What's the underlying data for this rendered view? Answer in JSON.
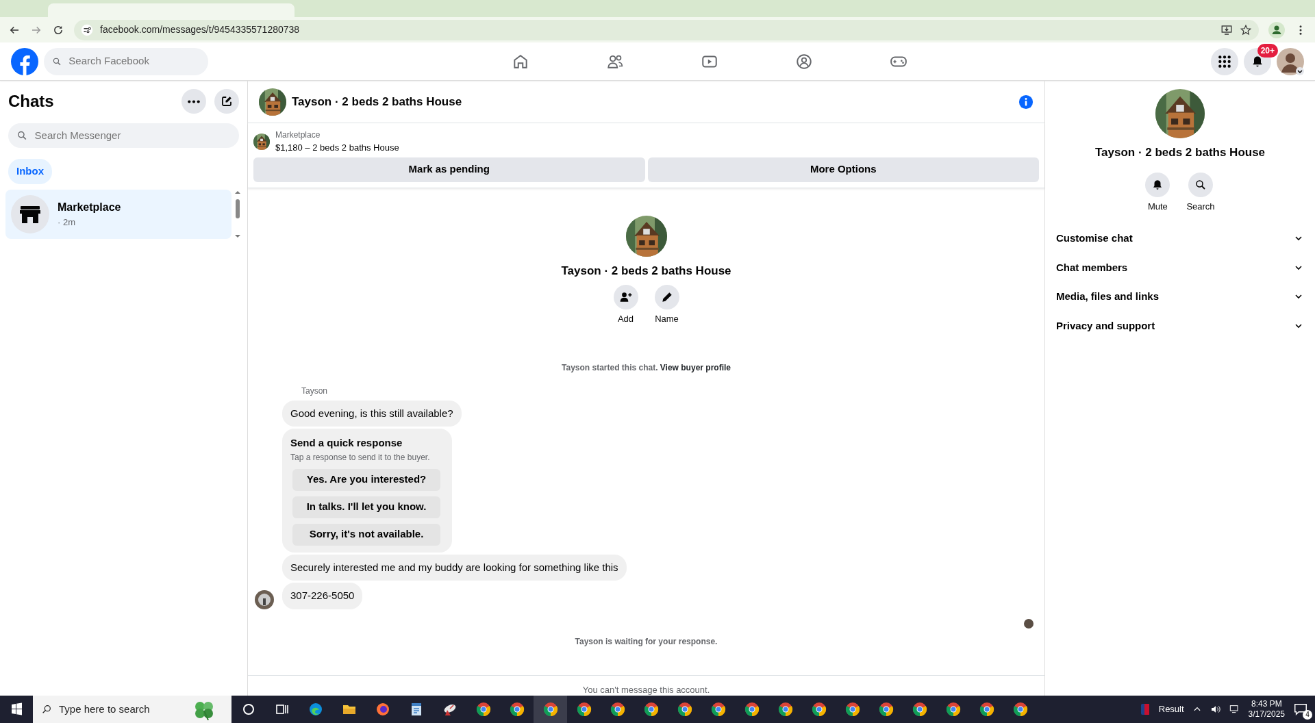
{
  "browser": {
    "url": "facebook.com/messages/t/9454335571280738"
  },
  "topbar": {
    "search_placeholder": "Search Facebook",
    "nav": [
      {
        "kind": "home"
      },
      {
        "kind": "friends"
      },
      {
        "kind": "video"
      },
      {
        "kind": "groups"
      },
      {
        "kind": "gaming"
      }
    ],
    "notification_badge": "20+"
  },
  "chats": {
    "title": "Chats",
    "search_placeholder": "Search Messenger",
    "filters": [
      {
        "label": "Inbox",
        "selected": true
      }
    ],
    "items": [
      {
        "name": "Marketplace",
        "meta": "· 2m",
        "selected": true
      }
    ]
  },
  "conversation": {
    "title": "Tayson · 2 beds 2 baths House",
    "listing": {
      "source": "Marketplace",
      "summary": "$1,180 – 2 beds 2 baths House"
    },
    "actions": [
      "Mark as pending",
      "More Options"
    ],
    "profile": {
      "name": "Tayson · 2 beds 2 baths House",
      "actions": [
        {
          "kind": "add",
          "label": "Add"
        },
        {
          "kind": "name",
          "label": "Name"
        }
      ]
    },
    "started": {
      "text": "Tayson started this chat.",
      "link": "View buyer profile"
    },
    "sender": "Tayson",
    "messages": [
      {
        "kind": "text",
        "text": "Good evening, is this still available?",
        "avatar": false
      },
      {
        "kind": "quick",
        "title": "Send a quick response",
        "hint": "Tap a response to send it to the buyer.",
        "options": [
          "Yes. Are you interested?",
          "In talks. I'll let you know.",
          "Sorry, it's not available."
        ]
      },
      {
        "kind": "text",
        "text": "Securely interested me and my buddy are looking for something like this",
        "avatar": false
      },
      {
        "kind": "text",
        "text": "307-226-5050",
        "avatar": true
      }
    ],
    "waiting": "Tayson is waiting for your response.",
    "footer": "You can't message this account."
  },
  "details": {
    "name": "Tayson · 2 beds 2 baths House",
    "actions": [
      {
        "kind": "mute",
        "label": "Mute"
      },
      {
        "kind": "search",
        "label": "Search"
      }
    ],
    "sections": [
      {
        "label": "Customise chat",
        "expanded": false
      },
      {
        "label": "Chat members",
        "expanded": false
      },
      {
        "label": "Media, files and links",
        "expanded": false
      },
      {
        "label": "Privacy and support",
        "expanded": false
      }
    ]
  },
  "taskbar": {
    "search_placeholder": "Type here to search",
    "apps": [
      {
        "kind": "cortana",
        "selected": false
      },
      {
        "kind": "taskview",
        "selected": false
      },
      {
        "kind": "edge",
        "selected": false
      },
      {
        "kind": "explorer",
        "selected": false
      },
      {
        "kind": "firefox",
        "selected": false
      },
      {
        "kind": "notepad",
        "selected": false
      },
      {
        "kind": "satellite",
        "selected": false
      },
      {
        "kind": "chrome",
        "selected": false
      },
      {
        "kind": "chrome",
        "selected": false
      },
      {
        "kind": "chrome",
        "selected": true
      },
      {
        "kind": "chrome",
        "selected": false
      },
      {
        "kind": "chrome",
        "selected": false
      },
      {
        "kind": "chrome",
        "selected": false
      },
      {
        "kind": "chrome",
        "selected": false
      },
      {
        "kind": "chrome",
        "selected": false
      },
      {
        "kind": "chrome",
        "selected": false
      },
      {
        "kind": "chrome",
        "selected": false
      },
      {
        "kind": "chrome",
        "selected": false
      },
      {
        "kind": "chrome",
        "selected": false
      },
      {
        "kind": "chrome",
        "selected": false
      },
      {
        "kind": "chrome",
        "selected": false
      },
      {
        "kind": "chrome",
        "selected": false
      },
      {
        "kind": "chrome",
        "selected": false
      },
      {
        "kind": "chrome",
        "selected": false
      }
    ],
    "weather": "Result",
    "time": "8:43 PM",
    "date": "3/17/2025",
    "notifications": "4"
  }
}
